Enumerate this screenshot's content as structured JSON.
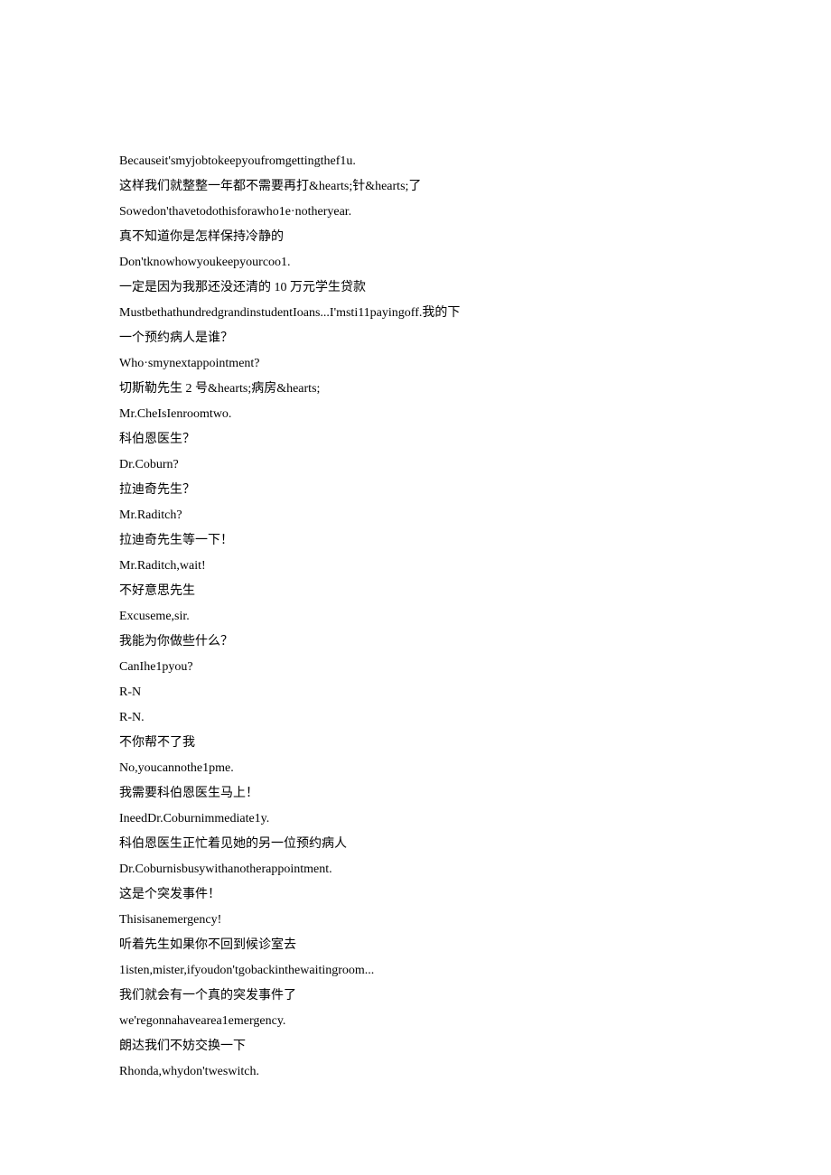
{
  "lines": [
    "Becauseit'smyjobtokeepyoufromgettingthef1u.",
    "这样我们就整整一年都不需要再打&hearts;针&hearts;了",
    "Sowedon'thavetodothisforawho1e·notheryear.",
    "真不知道你是怎样保持冷静的",
    "Don'tknowhowyoukeepyourcoo1.",
    "一定是因为我那还没还清的 10 万元学生贷款",
    "MustbethathundredgrandinstudentIoans...I'msti11payingoff.我的下",
    "一个预约病人是谁？",
    "Who·smynextappointment?",
    "切斯勒先生 2 号&hearts;病房&hearts;",
    "Mr.CheIsIenroomtwo.",
    "科伯恩医生？",
    "Dr.Coburn?",
    "拉迪奇先生？",
    "Mr.Raditch?",
    "拉迪奇先生等一下！",
    "Mr.Raditch,wait!",
    "不好意思先生",
    "Excuseme,sir.",
    "我能为你做些什么？",
    "CanIhe1pyou?",
    "R-N",
    "R-N.",
    "不你帮不了我",
    "No,youcannothe1pme.",
    "我需要科伯恩医生马上！",
    "IneedDr.Coburnimmediate1y.",
    "科伯恩医生正忙着见她的另一位预约病人",
    "Dr.Coburnisbusywithanotherappointment.",
    "这是个突发事件！",
    "Thisisanemergency!",
    "听着先生如果你不回到候诊室去",
    "1isten,mister,ifyoudon'tgobackinthewaitingroom...",
    "我们就会有一个真的突发事件了",
    "we'regonnahaveareа1emergency.",
    "朗达我们不妨交换一下",
    "Rhonda,whydon'tweswitch."
  ]
}
